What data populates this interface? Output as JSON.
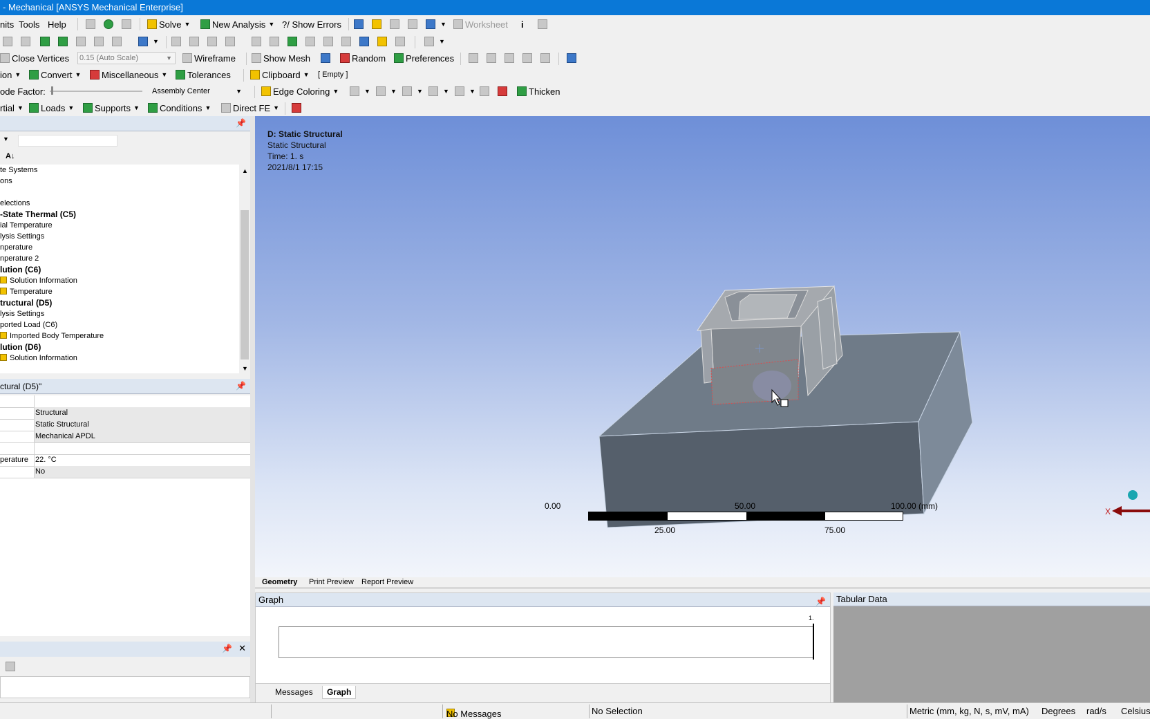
{
  "window": {
    "title": "- Mechanical [ANSYS Mechanical Enterprise]"
  },
  "menu": {
    "units": "nits",
    "tools": "Tools",
    "help": "Help",
    "solve": "Solve",
    "new_analysis": "New Analysis",
    "show_errors": "?/ Show Errors",
    "worksheet": "Worksheet"
  },
  "toolbar3": {
    "close_vertices": "Close Vertices",
    "scale": "0.15 (Auto Scale)",
    "wireframe": "Wireframe",
    "show_mesh": "Show Mesh",
    "random": "Random",
    "preferences": "Preferences"
  },
  "toolbar4": {
    "ion": "ion",
    "convert": "Convert",
    "misc": "Miscellaneous",
    "tolerances": "Tolerances",
    "clipboard": "Clipboard",
    "empty": "[ Empty ]"
  },
  "toolbar5": {
    "node_factor": "ode Factor:",
    "assembly": "Assembly Center",
    "edge_coloring": "Edge Coloring",
    "thicken": "Thicken"
  },
  "toolbar6": {
    "inertial": "rtial",
    "loads": "Loads",
    "supports": "Supports",
    "conditions": "Conditions",
    "direct_fe": "Direct FE"
  },
  "tree": {
    "rows": [
      {
        "text": "te Systems",
        "indent": 0,
        "bold": false
      },
      {
        "text": "ons",
        "indent": 0,
        "bold": false
      },
      {
        "text": "",
        "indent": 0,
        "bold": false
      },
      {
        "text": "elections",
        "indent": 0,
        "bold": false
      },
      {
        "text": "-State Thermal (C5)",
        "indent": 0,
        "bold": true
      },
      {
        "text": "ial Temperature",
        "indent": 0,
        "bold": false
      },
      {
        "text": "lysis Settings",
        "indent": 0,
        "bold": false
      },
      {
        "text": "nperature",
        "indent": 0,
        "bold": false
      },
      {
        "text": "nperature 2",
        "indent": 0,
        "bold": false
      },
      {
        "text": "lution (C6)",
        "indent": 0,
        "bold": true
      },
      {
        "text": "Solution Information",
        "indent": 1,
        "bold": false
      },
      {
        "text": "Temperature",
        "indent": 1,
        "bold": false
      },
      {
        "text": "tructural (D5)",
        "indent": 0,
        "bold": true
      },
      {
        "text": "lysis Settings",
        "indent": 0,
        "bold": false
      },
      {
        "text": "ported Load (C6)",
        "indent": 0,
        "bold": false
      },
      {
        "text": "Imported Body Temperature",
        "indent": 1,
        "bold": false
      },
      {
        "text": "lution (D6)",
        "indent": 0,
        "bold": true
      },
      {
        "text": "Solution Information",
        "indent": 1,
        "bold": false
      }
    ]
  },
  "details": {
    "title": "ctural (D5)\"",
    "rows": [
      {
        "k": "",
        "v": ""
      },
      {
        "k": "",
        "v": "Structural"
      },
      {
        "k": "",
        "v": "Static Structural"
      },
      {
        "k": "",
        "v": "Mechanical APDL"
      },
      {
        "k": "",
        "v": ""
      },
      {
        "k": "perature",
        "v": "22. °C"
      },
      {
        "k": "",
        "v": "No"
      }
    ]
  },
  "viewport": {
    "info_title": "D: Static Structural",
    "info_type": "Static Structural",
    "info_time": "Time: 1. s",
    "info_date": "2021/8/1 17:15",
    "scale_0": "0.00",
    "scale_50": "50.00",
    "scale_100": "100.00 (mm)",
    "scale_25": "25.00",
    "scale_75": "75.00"
  },
  "view_tabs": {
    "geometry": "Geometry",
    "print_preview": "Print Preview",
    "report_preview": "Report Preview"
  },
  "graph": {
    "title": "Graph",
    "tick": "1."
  },
  "tabular": {
    "title": "Tabular Data"
  },
  "bottom_tabs": {
    "messages": "Messages",
    "graph": "Graph"
  },
  "status": {
    "messages": "No Messages",
    "selection": "No Selection",
    "units": "Metric (mm, kg, N, s, mV, mA)",
    "degrees": "Degrees",
    "rads": "rad/s",
    "celsius": "Celsius"
  }
}
